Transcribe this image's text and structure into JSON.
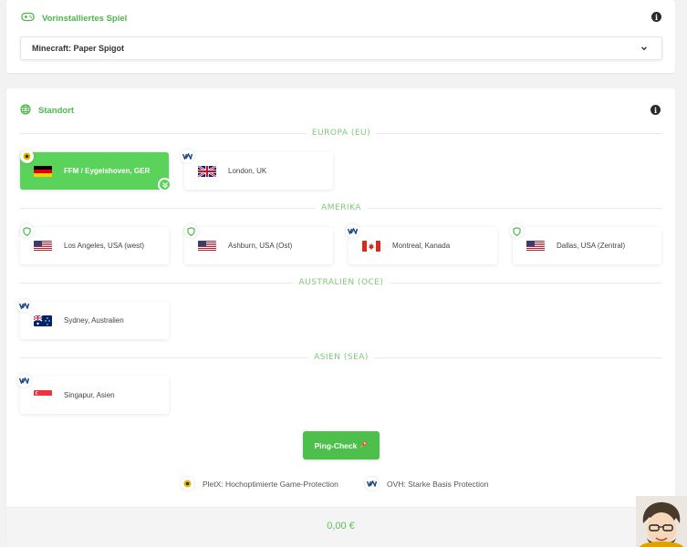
{
  "game": {
    "title": "Vorinstalliertes Spiel",
    "selected": "Minecraft: Paper Spigot"
  },
  "location": {
    "title": "Standort",
    "regions": [
      {
        "label": "EUROPA (EU)"
      },
      {
        "label": "AMERIKA"
      },
      {
        "label": "AUSTRALIEN (OCE)"
      },
      {
        "label": "ASIEN (SEA)"
      }
    ],
    "locations": [
      {
        "name": "FFM / Eygelshoven, GER",
        "flag": "de",
        "protection": "pletx",
        "selected": true
      },
      {
        "name": "London, UK",
        "flag": "uk",
        "protection": "ovh",
        "selected": false
      },
      {
        "name": "Los Angeles, USA (west)",
        "flag": "us",
        "protection": "shield",
        "selected": false
      },
      {
        "name": "Ashburn, USA (Ost)",
        "flag": "us",
        "protection": "shield",
        "selected": false
      },
      {
        "name": "Montreal, Kanada",
        "flag": "ca",
        "protection": "ovh",
        "selected": false
      },
      {
        "name": "Dallas, USA (Zentral)",
        "flag": "us",
        "protection": "shield",
        "selected": false
      },
      {
        "name": "Sydney, Australien",
        "flag": "au",
        "protection": "ovh",
        "selected": false
      },
      {
        "name": "Singapur, Asien",
        "flag": "sg",
        "protection": "ovh",
        "selected": false
      }
    ]
  },
  "ping_button": "Ping-Check",
  "legend": {
    "pletx": "PletX: Hochoptimierte Game-Protection",
    "ovh": "OVH: Starke Basis Protection"
  },
  "price": "0,00 €",
  "colors": {
    "accent": "#4cb848",
    "selected_bg": "#5bd35a"
  }
}
